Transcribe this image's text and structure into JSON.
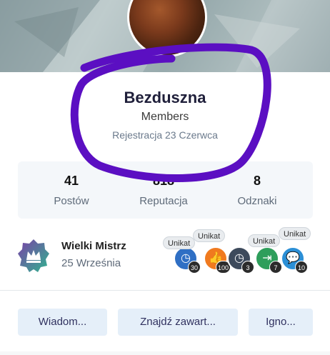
{
  "profile": {
    "name": "Bezduszna",
    "group": "Members",
    "joined": "Rejestracja 23 Czerwca"
  },
  "stats": [
    {
      "value": "41",
      "label": "Postów"
    },
    {
      "value": "818",
      "label": "Reputacja"
    },
    {
      "value": "8",
      "label": "Odznaki"
    }
  ],
  "rank": {
    "title": "Wielki Mistrz",
    "date": "25 Września",
    "icon": "crown-icon"
  },
  "achievements": [
    {
      "icon": "clock-icon",
      "count": "30",
      "color": "#2f6fc4",
      "rare": true,
      "rare_label": "Unikat"
    },
    {
      "icon": "thumbs-up-icon",
      "count": "100",
      "color": "#f07a1f",
      "rare": true,
      "rare_label": "Unikat"
    },
    {
      "icon": "clock-icon",
      "count": "3",
      "color": "#3d4a5c",
      "rare": false
    },
    {
      "icon": "sign-in-icon",
      "count": "7",
      "color": "#2e9e5b",
      "rare": true,
      "rare_label": "Unikat"
    },
    {
      "icon": "comments-icon",
      "count": "10",
      "color": "#2b8fd6",
      "rare": true,
      "rare_label": "Unikat"
    }
  ],
  "actions": {
    "message": "Wiadom...",
    "find_content": "Znajdź zawart...",
    "ignore": "Igno..."
  },
  "colors": {
    "accent": "#30315f",
    "button_bg": "#e5eff9",
    "scribble": "#5b0fc2"
  }
}
